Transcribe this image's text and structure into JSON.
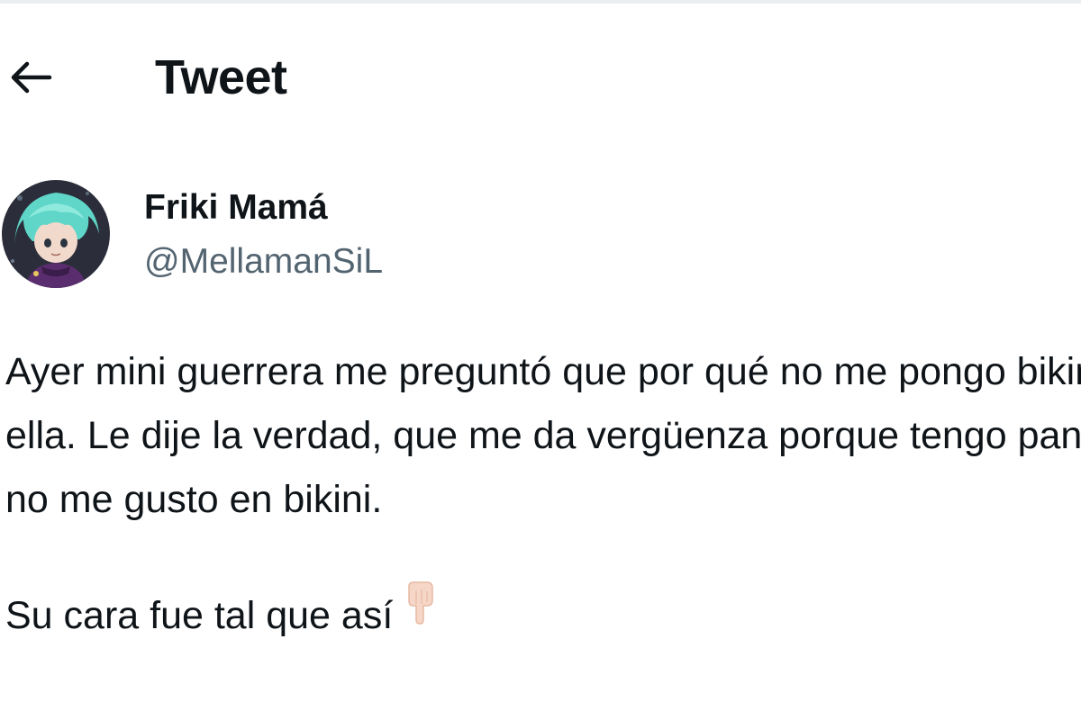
{
  "header": {
    "back_icon": "arrow-left-icon",
    "title": "Tweet"
  },
  "author": {
    "avatar_icon": "avatar-image",
    "display_name": "Friki Mamá",
    "handle": "@MellamanSiL"
  },
  "tweet": {
    "lines": [
      "Ayer mini guerrera me preguntó que por qué no me pongo bikini como",
      "ella. Le dije la verdad, que me da vergüenza porque tengo panza y",
      "no me gusto en bikini.",
      "",
      "Su cara fue tal que así"
    ],
    "emoji_icon": "pointing-down-hand-icon"
  },
  "colors": {
    "text_primary": "#0f1419",
    "text_secondary": "#536471",
    "background": "#ffffff",
    "border": "#eceff1"
  }
}
